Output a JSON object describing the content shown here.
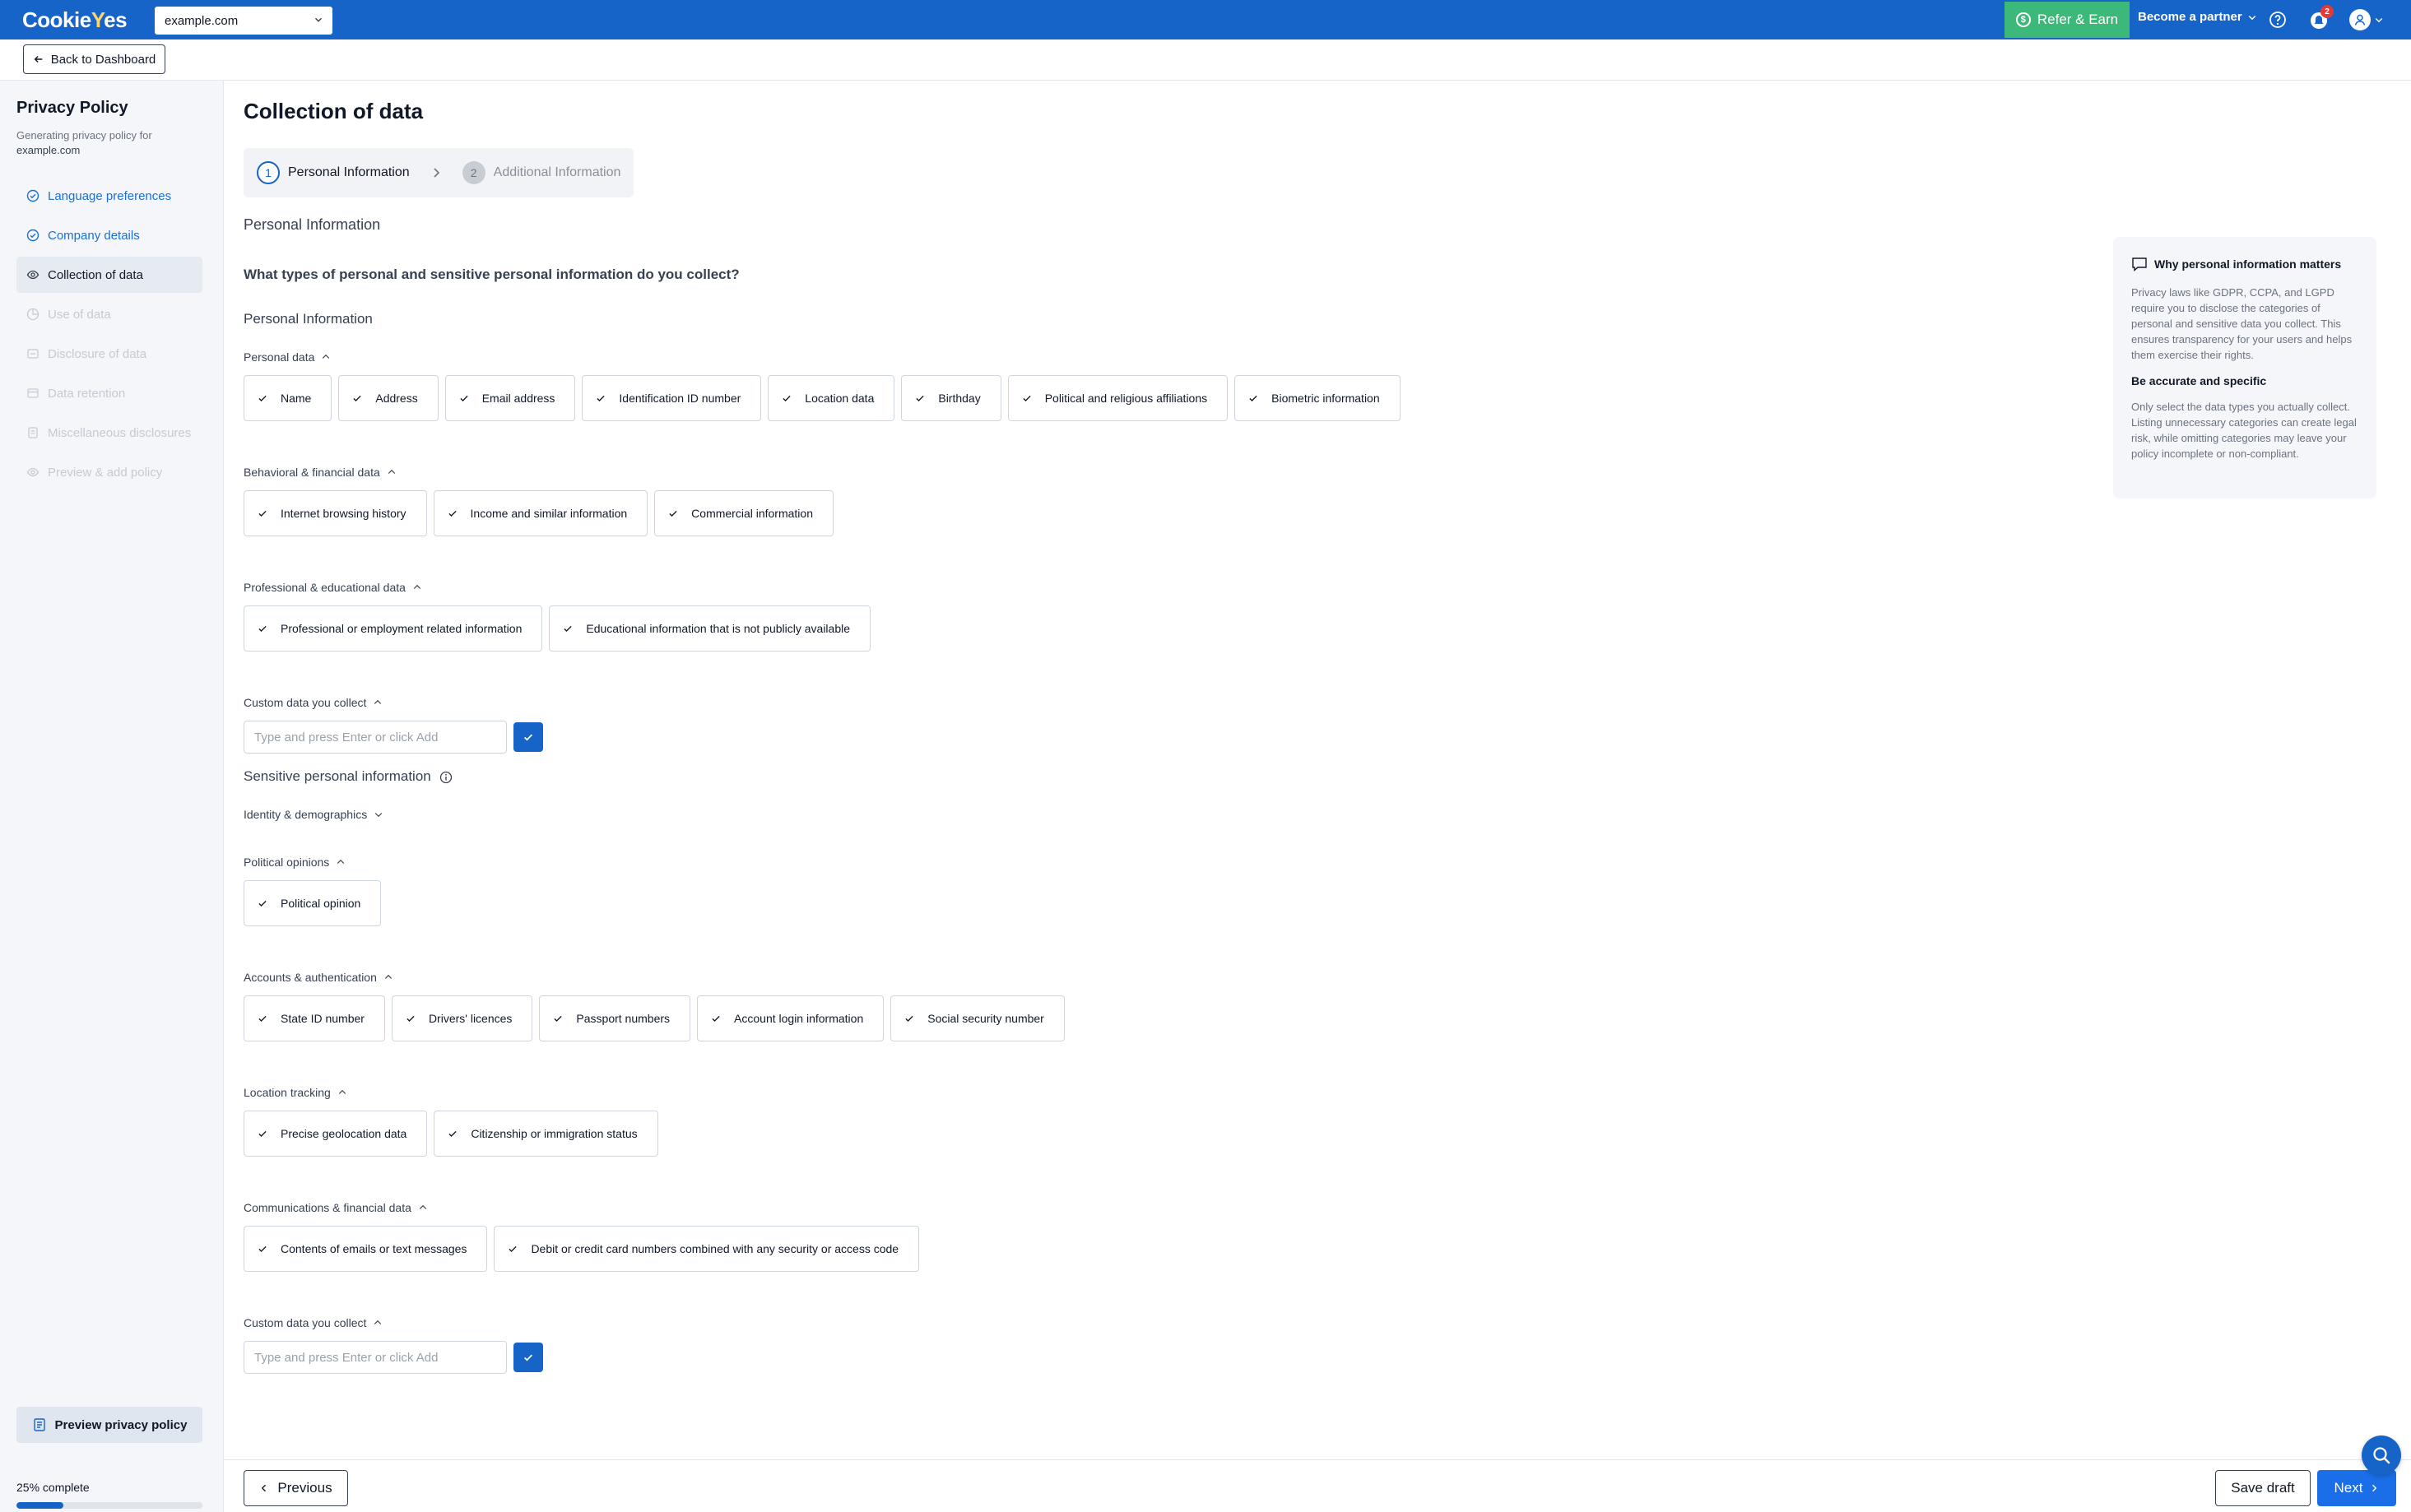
{
  "brand": {
    "logo_prefix": "Cookie",
    "logo_accent": "Y",
    "logo_suffix": "es",
    "accent_color": "#1764c8"
  },
  "topbar": {
    "domain_value": "example.com",
    "refer_label": "Refer & Earn",
    "partner_label": "Become a partner",
    "notification_count": "2"
  },
  "subbar": {
    "back_label": "Back to Dashboard"
  },
  "sidebar": {
    "title": "Privacy Policy",
    "subtitle": "Generating privacy policy for",
    "domain": "example.com",
    "items": [
      {
        "label": "Language preferences",
        "state": "done"
      },
      {
        "label": "Company details",
        "state": "done"
      },
      {
        "label": "Collection of data",
        "state": "active"
      },
      {
        "label": "Use of data",
        "state": "disabled"
      },
      {
        "label": "Disclosure of data",
        "state": "disabled"
      },
      {
        "label": "Data retention",
        "state": "disabled"
      },
      {
        "label": "Miscellaneous disclosures",
        "state": "disabled"
      },
      {
        "label": "Preview & add policy",
        "state": "disabled"
      }
    ],
    "preview_label": "Preview privacy policy",
    "progress_label": "25% complete",
    "progress_value": 25
  },
  "main": {
    "title": "Collection of data",
    "steps": [
      {
        "number": "1",
        "label": "Personal Information"
      },
      {
        "number": "2",
        "label": "Additional Information"
      }
    ],
    "section_title": "Personal Information",
    "question": "What types of personal and sensitive personal information do you collect?",
    "personal": {
      "heading": "Personal Information",
      "groups": [
        {
          "label": "Personal data",
          "items": [
            "Name",
            "Address",
            "Email address",
            "Identification ID number",
            "Location data",
            "Birthday",
            "Political and religious affiliations",
            "Biometric information"
          ]
        },
        {
          "label": "Behavioral & financial data",
          "items": [
            "Internet browsing history",
            "Income and similar information",
            "Commercial information"
          ]
        },
        {
          "label": "Professional & educational data",
          "items": [
            "Professional or employment related information",
            "Educational information that is not publicly available"
          ]
        }
      ],
      "custom_label": "Custom data you collect",
      "custom_placeholder": "Type and press Enter or click Add"
    },
    "sensitive": {
      "heading": "Sensitive personal information",
      "identity_label": "Identity & demographics",
      "groups": [
        {
          "label": "Political opinions",
          "items": [
            "Political opinion"
          ]
        },
        {
          "label": "Accounts & authentication",
          "items": [
            "State ID number",
            "Drivers' licences",
            "Passport numbers",
            "Account login information",
            "Social security number"
          ]
        },
        {
          "label": "Location tracking",
          "items": [
            "Precise geolocation data",
            "Citizenship or immigration status"
          ]
        },
        {
          "label": "Communications & financial data",
          "items": [
            "Contents of emails or text messages",
            "Debit or credit card numbers combined with any security or access code"
          ]
        }
      ],
      "custom_label": "Custom data you collect",
      "custom_placeholder": "Type and press Enter or click Add"
    }
  },
  "info_panel": {
    "title": "Why personal information matters",
    "text1": "Privacy laws like GDPR, CCPA, and LGPD require you to disclose the categories of personal and sensitive data you collect. This ensures transparency for your users and helps them exercise their rights.",
    "heading2": "Be accurate and specific",
    "text2": "Only select the data types you actually collect. Listing unnecessary categories can create legal risk, while omitting categories may leave your policy incomplete or non-compliant."
  },
  "footer": {
    "previous_label": "Previous",
    "draft_label": "Save draft",
    "next_label": "Next"
  }
}
